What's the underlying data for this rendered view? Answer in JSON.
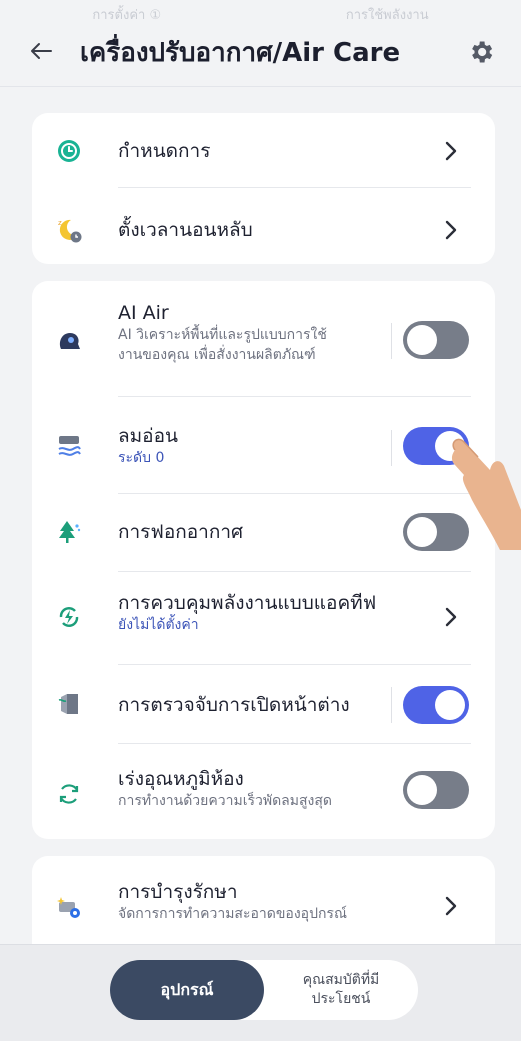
{
  "header": {
    "faded_tabs": [
      "การตั้งค่า ①",
      "การใช้พลังงาน"
    ],
    "title": "เครื่องปรับอากาศ/Air Care",
    "back_icon": "arrow-left-icon",
    "settings_icon": "gear-icon"
  },
  "card1": {
    "items": [
      {
        "label": "กำหนดการ",
        "icon": "clock-icon"
      },
      {
        "label": "ตั้งเวลานอนหลับ",
        "icon": "sleep-moon-icon"
      }
    ]
  },
  "card2": {
    "items": [
      {
        "label": "AI Air",
        "sub": "AI วิเคราะห์พื้นที่และรูปแบบการใช้",
        "sub2": "งานของคุณ เพื่อสั่งงานผลิตภัณฑ์",
        "toggle_on": false,
        "icon": "ai-head-icon"
      },
      {
        "label": "ลมอ่อน",
        "sub": "ระดับ 0",
        "toggle_on": true,
        "icon": "soft-wind-icon"
      },
      {
        "label": "การฟอกอากาศ",
        "toggle_on": false,
        "icon": "tree-purify-icon"
      },
      {
        "label": "การควบคุมพลังงานแบบแอคทีฟ",
        "sub": "ยังไม่ได้ตั้งค่า",
        "icon": "energy-control-icon"
      },
      {
        "label": "การตรวจจับการเปิดหน้าต่าง",
        "toggle_on": true,
        "icon": "window-detect-icon"
      },
      {
        "label": "เร่งอุณหภูมิห้อง",
        "sub": "การทำงานด้วยความเร็วพัดลมสูงสุด",
        "toggle_on": false,
        "icon": "rapid-temp-icon"
      }
    ]
  },
  "card3": {
    "items": [
      {
        "label": "การบำรุงรักษา",
        "sub": "จัดการการทำความสะอาดของอุปกรณ์",
        "icon": "maintenance-icon"
      }
    ]
  },
  "bottom": {
    "tab_active": "อุปกรณ์",
    "tab_inactive_line1": "คุณสมบัติที่มี",
    "tab_inactive_line2": "ประโยชน์"
  },
  "colors": {
    "accent": "#4f63e6",
    "toggle_off": "#777d89",
    "sub_blue": "#3d55b8",
    "active_tab": "#3b4a63"
  }
}
